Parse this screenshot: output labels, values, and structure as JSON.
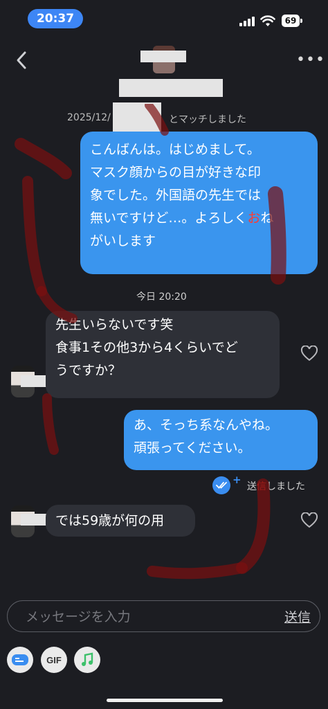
{
  "status_bar": {
    "time": "20:37",
    "battery": "69"
  },
  "colors": {
    "outgoing_bubble": "#3a95ee",
    "incoming_bubble": "#2e3037",
    "background": "#1c1d22",
    "accent": "#3d86f5",
    "red_text": "#ff3b30"
  },
  "header": {
    "back_icon": "chevron-left-icon",
    "more_icon": "ellipsis-icon",
    "more_label": "•••"
  },
  "match_notice": {
    "prefix": "2025/12/",
    "suffix": "とマッチしました"
  },
  "messages_out_1": {
    "lines": [
      "こんばんは。はじめまして。",
      "マスク顔からの目が好きな印",
      "象でした。外国語の先生では",
      "無いですけど…。よろしく",
      "がいします"
    ],
    "red_char": "お",
    "line4_tail": "ね"
  },
  "date_divider": "今日 20:20",
  "messages_in_1": {
    "lines": [
      "先生いらないです笑",
      "食事1その他3から4くらいでど",
      "うですか？"
    ]
  },
  "messages_out_2": {
    "lines": [
      "あ、そっち系なんやね。",
      "頑張ってください。"
    ]
  },
  "sent_status": {
    "part1": "送",
    "part2": "信",
    "part3": "しました"
  },
  "messages_in_2": {
    "text": "では59歳が何の用"
  },
  "input": {
    "placeholder": "メッセージを入力",
    "send_label": "送信"
  },
  "toolbar": {
    "gif_label": "GIF",
    "sticker_icon": "sticker-icon",
    "music_icon": "music-note-icon"
  }
}
